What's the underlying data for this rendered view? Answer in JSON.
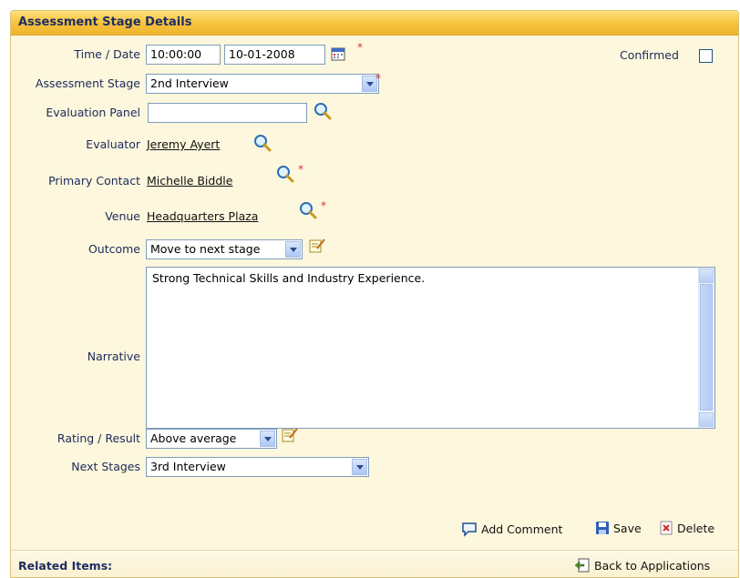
{
  "panel": {
    "title": "Assessment Stage Details"
  },
  "time_date": {
    "label": "Time / Date",
    "time": "10:00:00",
    "date": "10-01-2008"
  },
  "confirmed": {
    "label": "Confirmed"
  },
  "assessment_stage": {
    "label": "Assessment Stage",
    "value": "2nd Interview"
  },
  "evaluation_panel": {
    "label": "Evaluation Panel",
    "value": ""
  },
  "evaluator": {
    "label": "Evaluator",
    "value": "Jeremy Ayert"
  },
  "primary_contact": {
    "label": "Primary Contact",
    "value": "Michelle Biddle"
  },
  "venue": {
    "label": "Venue",
    "value": "Headquarters Plaza"
  },
  "outcome": {
    "label": "Outcome",
    "value": "Move to next stage"
  },
  "narrative": {
    "label": "Narrative",
    "value": "Strong Technical Skills and Industry Experience."
  },
  "rating": {
    "label": "Rating / Result",
    "value": "Above average"
  },
  "next_stages": {
    "label": "Next Stages",
    "value": "3rd Interview"
  },
  "actions": {
    "add_comment": "Add Comment",
    "save": "Save",
    "delete": "Delete"
  },
  "footer": {
    "related_items": "Related Items:",
    "back_to_applications": "Back to Applications"
  },
  "required_marker": "*",
  "colors": {
    "header": "#f5c23d",
    "panel_bg": "#fdf7dd",
    "required": "#e03030"
  }
}
